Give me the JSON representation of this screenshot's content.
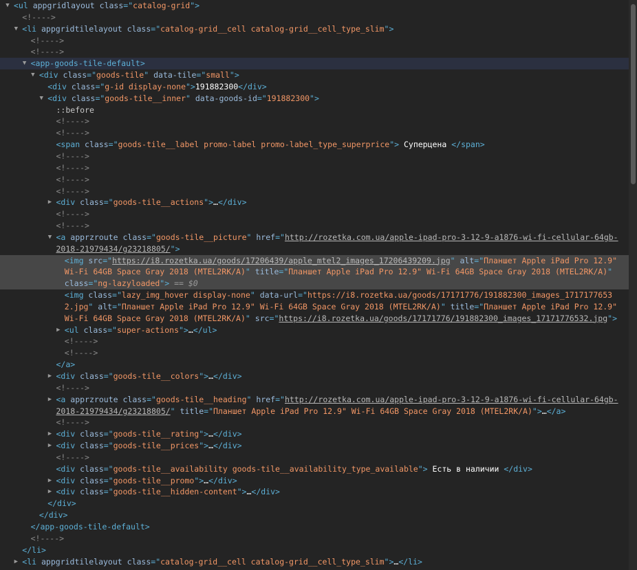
{
  "rows": [
    {
      "indent": 0,
      "tw": "open",
      "segs": [
        [
          "tag",
          "<ul "
        ],
        [
          "an",
          "appgridlayout"
        ],
        [
          "tag",
          " "
        ],
        [
          "an",
          "class"
        ],
        [
          "tag",
          "=\""
        ],
        [
          "av",
          "catalog-grid"
        ],
        [
          "tag",
          "\">"
        ]
      ]
    },
    {
      "indent": 1,
      "segs": [
        [
          "cm",
          "<!---->"
        ]
      ]
    },
    {
      "indent": 1,
      "tw": "open",
      "segs": [
        [
          "tag",
          "<li "
        ],
        [
          "an",
          "appgridtilelayout"
        ],
        [
          "tag",
          " "
        ],
        [
          "an",
          "class"
        ],
        [
          "tag",
          "=\""
        ],
        [
          "av",
          "catalog-grid__cell catalog-grid__cell_type_slim"
        ],
        [
          "tag",
          "\">"
        ]
      ]
    },
    {
      "indent": 2,
      "segs": [
        [
          "cm",
          "<!---->"
        ]
      ]
    },
    {
      "indent": 2,
      "segs": [
        [
          "cm",
          "<!---->"
        ]
      ]
    },
    {
      "indent": 2,
      "tw": "open",
      "hl": "hover",
      "segs": [
        [
          "tag",
          "<app-goods-tile-default>"
        ]
      ]
    },
    {
      "indent": 3,
      "tw": "open",
      "segs": [
        [
          "tag",
          "<div "
        ],
        [
          "an",
          "class"
        ],
        [
          "tag",
          "=\""
        ],
        [
          "av",
          "goods-tile"
        ],
        [
          "tag",
          "\" "
        ],
        [
          "an",
          "data-tile"
        ],
        [
          "tag",
          "=\""
        ],
        [
          "av",
          "small"
        ],
        [
          "tag",
          "\">"
        ]
      ]
    },
    {
      "indent": 4,
      "segs": [
        [
          "tag",
          "<div "
        ],
        [
          "an",
          "class"
        ],
        [
          "tag",
          "=\""
        ],
        [
          "av",
          "g-id display-none"
        ],
        [
          "tag",
          "\">"
        ],
        [
          "tx",
          "191882300"
        ],
        [
          "tag",
          "</div>"
        ]
      ]
    },
    {
      "indent": 4,
      "tw": "open",
      "segs": [
        [
          "tag",
          "<div "
        ],
        [
          "an",
          "class"
        ],
        [
          "tag",
          "=\""
        ],
        [
          "av",
          "goods-tile__inner"
        ],
        [
          "tag",
          "\" "
        ],
        [
          "an",
          "data-goods-id"
        ],
        [
          "tag",
          "=\""
        ],
        [
          "av",
          "191882300"
        ],
        [
          "tag",
          "\">"
        ]
      ]
    },
    {
      "indent": 5,
      "segs": [
        [
          "pe",
          "::before"
        ]
      ]
    },
    {
      "indent": 5,
      "segs": [
        [
          "cm",
          "<!---->"
        ]
      ]
    },
    {
      "indent": 5,
      "segs": [
        [
          "cm",
          "<!---->"
        ]
      ]
    },
    {
      "indent": 5,
      "segs": [
        [
          "tag",
          "<span "
        ],
        [
          "an",
          "class"
        ],
        [
          "tag",
          "=\""
        ],
        [
          "av",
          "goods-tile__label promo-label promo-label_type_superprice"
        ],
        [
          "tag",
          "\">"
        ],
        [
          "tx",
          " Суперцена "
        ],
        [
          "tag",
          "</span>"
        ]
      ]
    },
    {
      "indent": 5,
      "segs": [
        [
          "cm",
          "<!---->"
        ]
      ]
    },
    {
      "indent": 5,
      "segs": [
        [
          "cm",
          "<!---->"
        ]
      ]
    },
    {
      "indent": 5,
      "segs": [
        [
          "cm",
          "<!---->"
        ]
      ]
    },
    {
      "indent": 5,
      "segs": [
        [
          "cm",
          "<!---->"
        ]
      ]
    },
    {
      "indent": 5,
      "tw": "closed",
      "segs": [
        [
          "tag",
          "<div "
        ],
        [
          "an",
          "class"
        ],
        [
          "tag",
          "=\""
        ],
        [
          "av",
          "goods-tile__actions"
        ],
        [
          "tag",
          "\">"
        ],
        [
          "tx",
          "…"
        ],
        [
          "tag",
          "</div>"
        ]
      ]
    },
    {
      "indent": 5,
      "segs": [
        [
          "cm",
          "<!---->"
        ]
      ]
    },
    {
      "indent": 5,
      "segs": [
        [
          "cm",
          "<!---->"
        ]
      ]
    },
    {
      "indent": 5,
      "tw": "open",
      "segs": [
        [
          "tag",
          "<a "
        ],
        [
          "an",
          "apprzroute"
        ],
        [
          "tag",
          " "
        ],
        [
          "an",
          "class"
        ],
        [
          "tag",
          "=\""
        ],
        [
          "av",
          "goods-tile__picture"
        ],
        [
          "tag",
          "\" "
        ],
        [
          "an",
          "href"
        ],
        [
          "tag",
          "=\""
        ],
        [
          "link",
          "http://rozetka.com.ua/apple-ipad-pro-3-12-9-a1876-wi-fi-cellular-64gb-2018-21979434/g23218805/"
        ],
        [
          "tag",
          "\">"
        ]
      ]
    },
    {
      "indent": 6,
      "hl": "sel",
      "segs": [
        [
          "tag",
          "<img "
        ],
        [
          "an",
          "src"
        ],
        [
          "tag",
          "=\""
        ],
        [
          "link",
          "https://i8.rozetka.ua/goods/17206439/apple_mtel2_images_17206439209.jpg"
        ],
        [
          "tag",
          "\" "
        ],
        [
          "an",
          "alt"
        ],
        [
          "tag",
          "=\""
        ],
        [
          "av",
          "Планшет Apple iPad Pro 12.9\" Wi-Fi 64GB Space Gray 2018 (MTEL2RK/A)"
        ],
        [
          "tag",
          "\" "
        ],
        [
          "an",
          "title"
        ],
        [
          "tag",
          "=\""
        ],
        [
          "av",
          "Планшет Apple iPad Pro 12.9\" Wi-Fi 64GB Space Gray 2018 (MTEL2RK/A)"
        ],
        [
          "tag",
          "\" "
        ],
        [
          "an",
          "class"
        ],
        [
          "tag",
          "=\""
        ],
        [
          "av",
          "ng-lazyloaded"
        ],
        [
          "tag",
          "\">"
        ],
        [
          "dim",
          " == $0"
        ]
      ]
    },
    {
      "indent": 6,
      "segs": [
        [
          "tag",
          "<img "
        ],
        [
          "an",
          "class"
        ],
        [
          "tag",
          "=\""
        ],
        [
          "av",
          "lazy_img_hover display-none"
        ],
        [
          "tag",
          "\" "
        ],
        [
          "an",
          "data-url"
        ],
        [
          "tag",
          "=\""
        ],
        [
          "av",
          "https://i8.rozetka.ua/goods/17171776/191882300_images_17171776532.jpg"
        ],
        [
          "tag",
          "\" "
        ],
        [
          "an",
          "alt"
        ],
        [
          "tag",
          "=\""
        ],
        [
          "av",
          "Планшет Apple iPad Pro 12.9\" Wi-Fi 64GB Space Gray 2018 (MTEL2RK/A)"
        ],
        [
          "tag",
          "\" "
        ],
        [
          "an",
          "title"
        ],
        [
          "tag",
          "=\""
        ],
        [
          "av",
          "Планшет Apple iPad Pro 12.9\" Wi-Fi 64GB Space Gray 2018 (MTEL2RK/A)"
        ],
        [
          "tag",
          "\" "
        ],
        [
          "an",
          "src"
        ],
        [
          "tag",
          "=\""
        ],
        [
          "link",
          "https://i8.rozetka.ua/goods/17171776/191882300_images_17171776532.jpg"
        ],
        [
          "tag",
          "\">"
        ]
      ]
    },
    {
      "indent": 6,
      "tw": "closed",
      "segs": [
        [
          "tag",
          "<ul "
        ],
        [
          "an",
          "class"
        ],
        [
          "tag",
          "=\""
        ],
        [
          "av",
          "super-actions"
        ],
        [
          "tag",
          "\">"
        ],
        [
          "tx",
          "…"
        ],
        [
          "tag",
          "</ul>"
        ]
      ]
    },
    {
      "indent": 6,
      "segs": [
        [
          "cm",
          "<!---->"
        ]
      ]
    },
    {
      "indent": 6,
      "segs": [
        [
          "cm",
          "<!---->"
        ]
      ]
    },
    {
      "indent": 5,
      "segs": [
        [
          "tag",
          "</a>"
        ]
      ]
    },
    {
      "indent": 5,
      "tw": "closed",
      "segs": [
        [
          "tag",
          "<div "
        ],
        [
          "an",
          "class"
        ],
        [
          "tag",
          "=\""
        ],
        [
          "av",
          "goods-tile__colors"
        ],
        [
          "tag",
          "\">"
        ],
        [
          "tx",
          "…"
        ],
        [
          "tag",
          "</div>"
        ]
      ]
    },
    {
      "indent": 5,
      "segs": [
        [
          "cm",
          "<!---->"
        ]
      ]
    },
    {
      "indent": 5,
      "tw": "closed",
      "segs": [
        [
          "tag",
          "<a "
        ],
        [
          "an",
          "apprzroute"
        ],
        [
          "tag",
          " "
        ],
        [
          "an",
          "class"
        ],
        [
          "tag",
          "=\""
        ],
        [
          "av",
          "goods-tile__heading"
        ],
        [
          "tag",
          "\" "
        ],
        [
          "an",
          "href"
        ],
        [
          "tag",
          "=\""
        ],
        [
          "link",
          "http://rozetka.com.ua/apple-ipad-pro-3-12-9-a1876-wi-fi-cellular-64gb-2018-21979434/g23218805/"
        ],
        [
          "tag",
          "\" "
        ],
        [
          "an",
          "title"
        ],
        [
          "tag",
          "=\""
        ],
        [
          "av",
          "Планшет Apple iPad Pro 12.9\" Wi-Fi 64GB Space Gray 2018 (MTEL2RK/A)"
        ],
        [
          "tag",
          "\">"
        ],
        [
          "tx",
          "…"
        ],
        [
          "tag",
          "</a>"
        ]
      ]
    },
    {
      "indent": 5,
      "segs": [
        [
          "cm",
          "<!---->"
        ]
      ]
    },
    {
      "indent": 5,
      "tw": "closed",
      "segs": [
        [
          "tag",
          "<div "
        ],
        [
          "an",
          "class"
        ],
        [
          "tag",
          "=\""
        ],
        [
          "av",
          "goods-tile__rating"
        ],
        [
          "tag",
          "\">"
        ],
        [
          "tx",
          "…"
        ],
        [
          "tag",
          "</div>"
        ]
      ]
    },
    {
      "indent": 5,
      "tw": "closed",
      "segs": [
        [
          "tag",
          "<div "
        ],
        [
          "an",
          "class"
        ],
        [
          "tag",
          "=\""
        ],
        [
          "av",
          "goods-tile__prices"
        ],
        [
          "tag",
          "\">"
        ],
        [
          "tx",
          "…"
        ],
        [
          "tag",
          "</div>"
        ]
      ]
    },
    {
      "indent": 5,
      "segs": [
        [
          "cm",
          "<!---->"
        ]
      ]
    },
    {
      "indent": 5,
      "segs": [
        [
          "tag",
          "<div "
        ],
        [
          "an",
          "class"
        ],
        [
          "tag",
          "=\""
        ],
        [
          "av",
          "goods-tile__availability goods-tile__availability_type_available"
        ],
        [
          "tag",
          "\">"
        ],
        [
          "tx",
          " Есть в наличии "
        ],
        [
          "tag",
          "</div>"
        ]
      ]
    },
    {
      "indent": 5,
      "tw": "closed",
      "segs": [
        [
          "tag",
          "<div "
        ],
        [
          "an",
          "class"
        ],
        [
          "tag",
          "=\""
        ],
        [
          "av",
          "goods-tile__promo"
        ],
        [
          "tag",
          "\">"
        ],
        [
          "tx",
          "…"
        ],
        [
          "tag",
          "</div>"
        ]
      ]
    },
    {
      "indent": 5,
      "tw": "closed",
      "segs": [
        [
          "tag",
          "<div "
        ],
        [
          "an",
          "class"
        ],
        [
          "tag",
          "=\""
        ],
        [
          "av",
          "goods-tile__hidden-content"
        ],
        [
          "tag",
          "\">"
        ],
        [
          "tx",
          "…"
        ],
        [
          "tag",
          "</div>"
        ]
      ]
    },
    {
      "indent": 4,
      "segs": [
        [
          "tag",
          "</div>"
        ]
      ]
    },
    {
      "indent": 3,
      "segs": [
        [
          "tag",
          "</div>"
        ]
      ]
    },
    {
      "indent": 2,
      "segs": [
        [
          "tag",
          "</app-goods-tile-default>"
        ]
      ]
    },
    {
      "indent": 2,
      "segs": [
        [
          "cm",
          "<!---->"
        ]
      ]
    },
    {
      "indent": 1,
      "segs": [
        [
          "tag",
          "</li>"
        ]
      ]
    },
    {
      "indent": 1,
      "tw": "closed",
      "segs": [
        [
          "tag",
          "<li "
        ],
        [
          "an",
          "appgridtilelayout"
        ],
        [
          "tag",
          " "
        ],
        [
          "an",
          "class"
        ],
        [
          "tag",
          "=\""
        ],
        [
          "av",
          "catalog-grid__cell catalog-grid__cell_type_slim"
        ],
        [
          "tag",
          "\">"
        ],
        [
          "tx",
          "…"
        ],
        [
          "tag",
          "</li>"
        ]
      ]
    }
  ]
}
